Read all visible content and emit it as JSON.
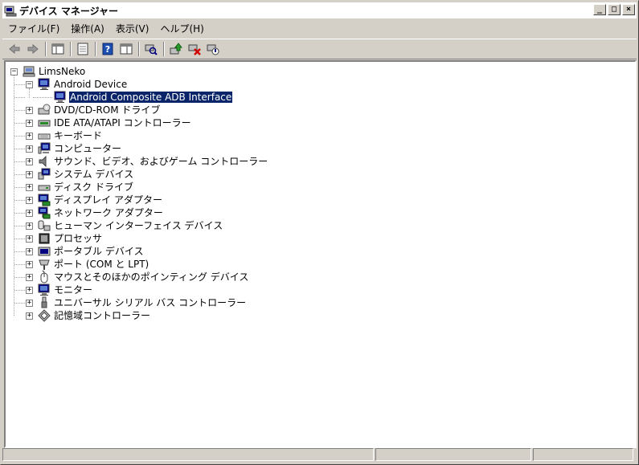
{
  "window": {
    "title": "デバイス マネージャー",
    "icon": "device-manager-icon",
    "controls": {
      "minimize": "_",
      "maximize": "□",
      "close": "×"
    }
  },
  "menu": {
    "items": [
      "ファイル(F)",
      "操作(A)",
      "表示(V)",
      "ヘルプ(H)"
    ]
  },
  "toolbar": {
    "buttons": [
      "back-icon",
      "forward-icon",
      "console-tree-icon",
      "properties-icon",
      "help-icon",
      "view-icon",
      "scan-hardware-icon",
      "update-driver-icon",
      "uninstall-icon",
      "disable-icon"
    ]
  },
  "tree": {
    "root": "LimsNeko",
    "items": [
      {
        "label": "Android Device",
        "expanded": true,
        "icon": "monitor-icon",
        "children": [
          {
            "label": "Android Composite ADB Interface",
            "selected": true,
            "icon": "monitor-icon"
          }
        ]
      },
      {
        "label": "DVD/CD-ROM ドライブ",
        "icon": "cdrom-icon"
      },
      {
        "label": "IDE ATA/ATAPI コントローラー",
        "icon": "ide-controller-icon"
      },
      {
        "label": "キーボード",
        "icon": "keyboard-icon"
      },
      {
        "label": "コンピューター",
        "icon": "computer-icon"
      },
      {
        "label": "サウンド、ビデオ、およびゲーム コントローラー",
        "icon": "speaker-icon"
      },
      {
        "label": "システム デバイス",
        "icon": "system-device-icon"
      },
      {
        "label": "ディスク ドライブ",
        "icon": "disk-drive-icon"
      },
      {
        "label": "ディスプレイ アダプター",
        "icon": "display-adapter-icon"
      },
      {
        "label": "ネットワーク アダプター",
        "icon": "network-adapter-icon"
      },
      {
        "label": "ヒューマン インターフェイス デバイス",
        "icon": "hid-icon"
      },
      {
        "label": "プロセッサ",
        "icon": "processor-icon"
      },
      {
        "label": "ポータブル デバイス",
        "icon": "portable-device-icon"
      },
      {
        "label": "ポート (COM と LPT)",
        "icon": "port-icon"
      },
      {
        "label": "マウスとそのほかのポインティング デバイス",
        "icon": "mouse-icon"
      },
      {
        "label": "モニター",
        "icon": "monitor-icon"
      },
      {
        "label": "ユニバーサル シリアル バス コントローラー",
        "icon": "usb-icon"
      },
      {
        "label": "記憶域コントローラー",
        "icon": "storage-controller-icon"
      }
    ]
  }
}
